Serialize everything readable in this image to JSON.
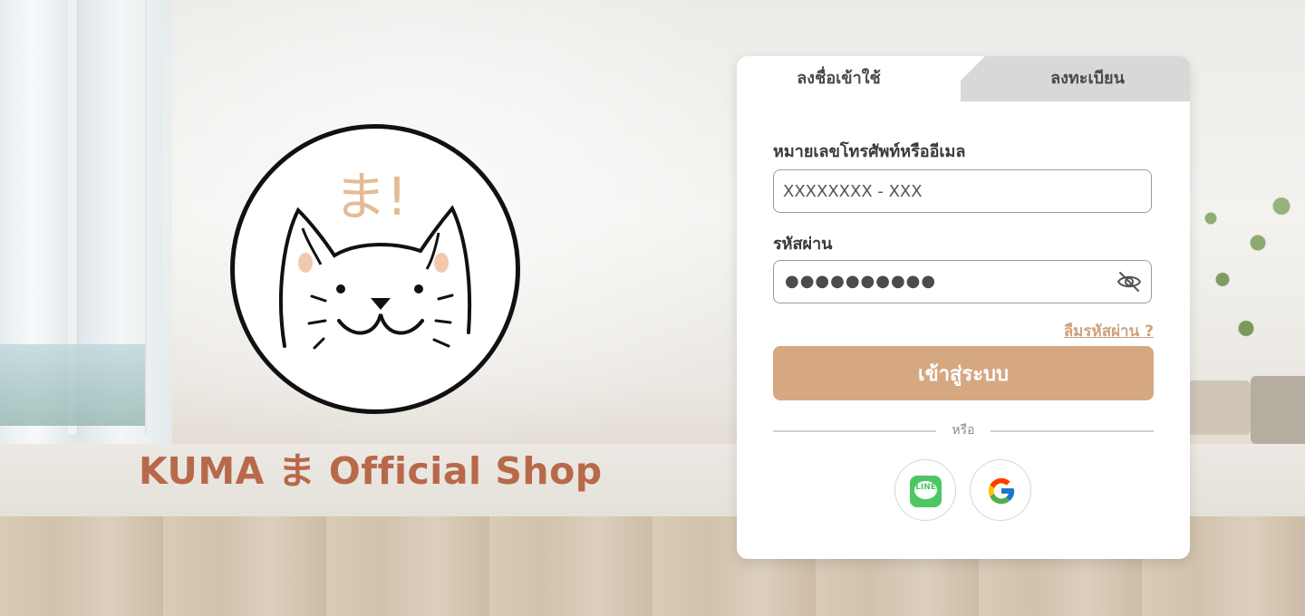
{
  "brand": {
    "shop_name": "KUMA ま Official Shop",
    "logo_text": "ま!"
  },
  "tabs": {
    "login_label": "ลงชื่อเข้าใช้",
    "register_label": "ลงทะเบียน"
  },
  "form": {
    "phone_email_label": "หมายเลขโทรศัพท์หรืออีเมล",
    "phone_email_placeholder": "XXXXXXXX - XXX",
    "password_label": "รหัสผ่าน",
    "password_value": "●●●●●●●●●●",
    "forgot_password": "ลืมรหัสผ่าน ?",
    "login_button": "เข้าสู่ระบบ",
    "divider_text": "หรือ"
  },
  "social": {
    "line_text": "LINE",
    "icons": [
      "line-icon",
      "google-icon"
    ]
  },
  "colors": {
    "accent": "#d6a882",
    "brand_text": "#b8694a",
    "link": "#d0a27b",
    "tab_inactive": "#d8d8d8"
  }
}
